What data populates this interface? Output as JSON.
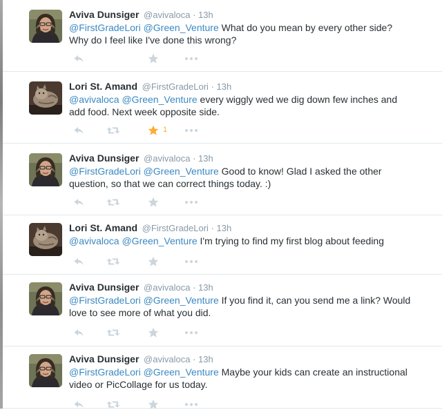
{
  "tweets": [
    {
      "avatar": "aviva-avatar",
      "name": "Aviva Dunsiger",
      "handle": "@avivaloca",
      "time": "13h",
      "mentions": [
        "@FirstGradeLori",
        "@Green_Venture"
      ],
      "text_lines": [
        "What do you mean by every other side?",
        "Why do I feel like I've done this wrong?"
      ],
      "retweet_visible": false,
      "favorited": false,
      "favorite_count": ""
    },
    {
      "avatar": "lori-avatar",
      "name": "Lori St. Amand",
      "handle": "@FirstGradeLori",
      "time": "13h",
      "mentions": [
        "@avivaloca",
        "@Green_Venture"
      ],
      "text_lines": [
        "every wiggly wed we dig down few inches and",
        "add food. Next week opposite side."
      ],
      "retweet_visible": true,
      "favorited": true,
      "favorite_count": "1"
    },
    {
      "avatar": "aviva-avatar",
      "name": "Aviva Dunsiger",
      "handle": "@avivaloca",
      "time": "13h",
      "mentions": [
        "@FirstGradeLori",
        "@Green_Venture"
      ],
      "text_lines": [
        "Good to know! Glad I asked the other",
        "question, so that we can correct things today. :)"
      ],
      "retweet_visible": true,
      "favorited": false,
      "favorite_count": ""
    },
    {
      "avatar": "lori-avatar",
      "name": "Lori St. Amand",
      "handle": "@FirstGradeLori",
      "time": "13h",
      "mentions": [
        "@avivaloca",
        "@Green_Venture"
      ],
      "text_lines": [
        "I'm trying to find my first blog about feeding"
      ],
      "retweet_visible": true,
      "favorited": false,
      "favorite_count": ""
    },
    {
      "avatar": "aviva-avatar",
      "name": "Aviva Dunsiger",
      "handle": "@avivaloca",
      "time": "13h",
      "mentions": [
        "@FirstGradeLori",
        "@Green_Venture"
      ],
      "text_lines": [
        "If you find it, can you send me a link? Would",
        "love to see more of what you did."
      ],
      "retweet_visible": true,
      "favorited": false,
      "favorite_count": ""
    },
    {
      "avatar": "aviva-avatar",
      "name": "Aviva Dunsiger",
      "handle": "@avivaloca",
      "time": "13h",
      "mentions": [
        "@FirstGradeLori",
        "@Green_Venture"
      ],
      "text_lines": [
        "Maybe your kids can create an instructional",
        "video or PicCollage for us today."
      ],
      "retweet_visible": true,
      "favorited": false,
      "favorite_count": ""
    }
  ],
  "separator": "·",
  "icons": {
    "reply": "reply-icon",
    "retweet": "retweet-icon",
    "favorite": "star-icon",
    "more": "more-icon"
  },
  "colors": {
    "mention": "#3b88c3",
    "action_icon": "#ccd6dd",
    "favorited": "#ffac33",
    "meta_text": "#8899a6",
    "divider": "#e1e8ed"
  }
}
